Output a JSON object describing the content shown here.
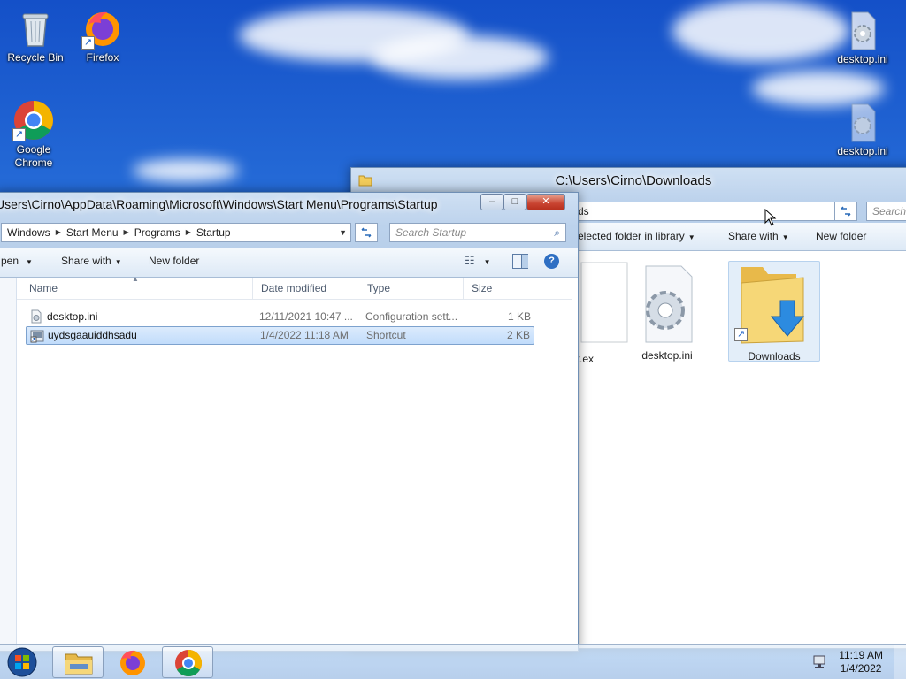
{
  "desktop": {
    "icons": [
      {
        "label": "Recycle Bin",
        "icon": "recycle-bin-icon"
      },
      {
        "label": "Firefox",
        "icon": "firefox-icon"
      },
      {
        "label": "Google Chrome",
        "icon": "chrome-icon"
      },
      {
        "label": "desktop.ini",
        "icon": "settings-file-icon"
      },
      {
        "label": "desktop.ini",
        "icon": "settings-file-icon"
      }
    ]
  },
  "downloads_window": {
    "title": "C:\\Users\\Cirno\\Downloads",
    "address_tail": "ds",
    "search_placeholder": "Search",
    "commands": {
      "include": "elected folder in library",
      "share": "Share with",
      "new_folder": "New folder"
    },
    "items": [
      {
        "label": "rk.ex"
      },
      {
        "label": "desktop.ini"
      },
      {
        "label": "Downloads"
      }
    ]
  },
  "startup_window": {
    "title": "Users\\Cirno\\AppData\\Roaming\\Microsoft\\Windows\\Start Menu\\Programs\\Startup",
    "breadcrumbs": [
      "Windows",
      "Start Menu",
      "Programs",
      "Startup"
    ],
    "search_placeholder": "Search Startup",
    "commands": {
      "open": "pen",
      "share": "Share with",
      "new_folder": "New folder"
    },
    "columns": [
      "Name",
      "Date modified",
      "Type",
      "Size"
    ],
    "files": [
      {
        "name": "desktop.ini",
        "date": "12/11/2021 10:47 ...",
        "type": "Configuration sett...",
        "size": "1 KB"
      },
      {
        "name": "uydsgaauiddhsadu",
        "date": "1/4/2022 11:18 AM",
        "type": "Shortcut",
        "size": "2 KB"
      }
    ]
  },
  "taskbar": {
    "time": "11:19 AM",
    "date": "1/4/2022"
  },
  "colors": {
    "accent": "#3a78c9",
    "selection": "#c1dcfb",
    "close": "#c94431"
  }
}
